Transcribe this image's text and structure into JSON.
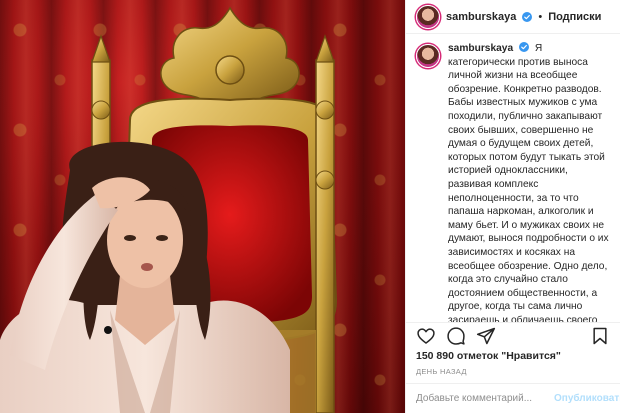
{
  "header": {
    "username": "samburskaya",
    "separator": "•",
    "follow_label": "Подписки"
  },
  "caption": {
    "username": "samburskaya",
    "text": "Я категорически против выноса личной жизни на всеобщее обозрение. Конкретно разводов. Бабы известных мужиков с ума походили, публично закапывают своих бывших, совершенно не думая о будущем своих детей, которых потом будут тыкать этой историей одноклассники, развивая комплекс неполноценности, за то что папаша наркоман, алкоголик и маму бьет. И о мужиках своих не думают, вынося подробности о их зависимостях и косяках на всеобщее обозрение. Одно дело, когда это случайно стало достоянием общественности, а другое, когда ты сама лично засираешь и обличаешь своего «никчёмыша». Ещё смешнее, когда"
  },
  "stats": {
    "likes": "150 890 отметок \"Нравится\"",
    "time_ago": "ДЕНЬ НАЗАД"
  },
  "comment": {
    "placeholder": "Добавьте комментарий...",
    "publish_label": "Опубликовать"
  },
  "colors": {
    "verified": "#3897f0",
    "story_ring": "#d62976",
    "publish_disabled": "#b2dffc",
    "curtain_red": "#8d1010",
    "throne_gold": "#c9a23e"
  },
  "icons": [
    "verified-badge-icon",
    "heart-icon",
    "comment-icon",
    "share-icon",
    "bookmark-icon"
  ]
}
